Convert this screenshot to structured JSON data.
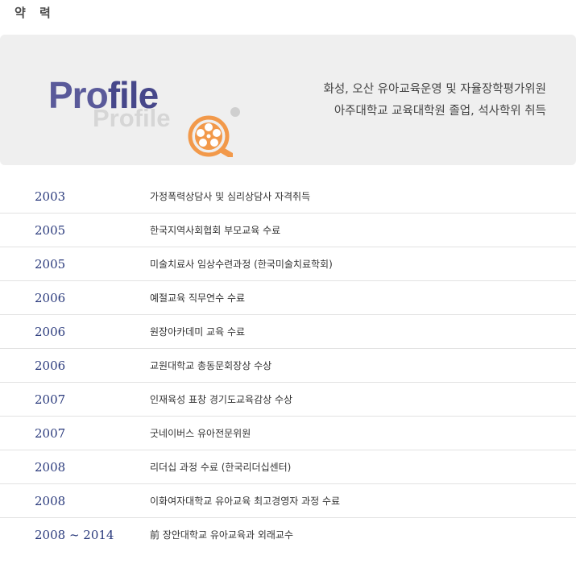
{
  "section": {
    "title": "약 력"
  },
  "profile": {
    "main_prefix": "Pro",
    "main_suffix": "file",
    "shadow_word": "Profile",
    "summary_lines": [
      "화성, 오산 유아교육운영 및 자율장학평가위원",
      "아주대학교 교육대학원 졸업, 석사학위 취득"
    ],
    "icon": "film-reel-magnifier-icon",
    "accent_color": "#f2994a"
  },
  "timeline": [
    {
      "year": "2003",
      "desc": "가정폭력상담사 및 심리상담사 자격취득"
    },
    {
      "year": "2005",
      "desc": "한국지역사회협회 부모교육 수료"
    },
    {
      "year": "2005",
      "desc": "미술치료사 임상수련과정 (한국미술치료학회)"
    },
    {
      "year": "2006",
      "desc": "예절교육 직무연수 수료"
    },
    {
      "year": "2006",
      "desc": "원장아카데미 교육 수료"
    },
    {
      "year": "2006",
      "desc": "교원대학교 총동문회장상 수상"
    },
    {
      "year": "2007",
      "desc": "인재육성 표창 경기도교육감상 수상"
    },
    {
      "year": "2007",
      "desc": "굿네이버스 유아전문위원"
    },
    {
      "year": "2008",
      "desc": "리더십 과정 수료 (한국리더십센터)"
    },
    {
      "year": "2008",
      "desc": "이화여자대학교 유아교육 최고경영자 과정 수료"
    },
    {
      "year": "2008 ~ 2014",
      "desc": "前 장안대학교 유아교육과 외래교수"
    }
  ]
}
